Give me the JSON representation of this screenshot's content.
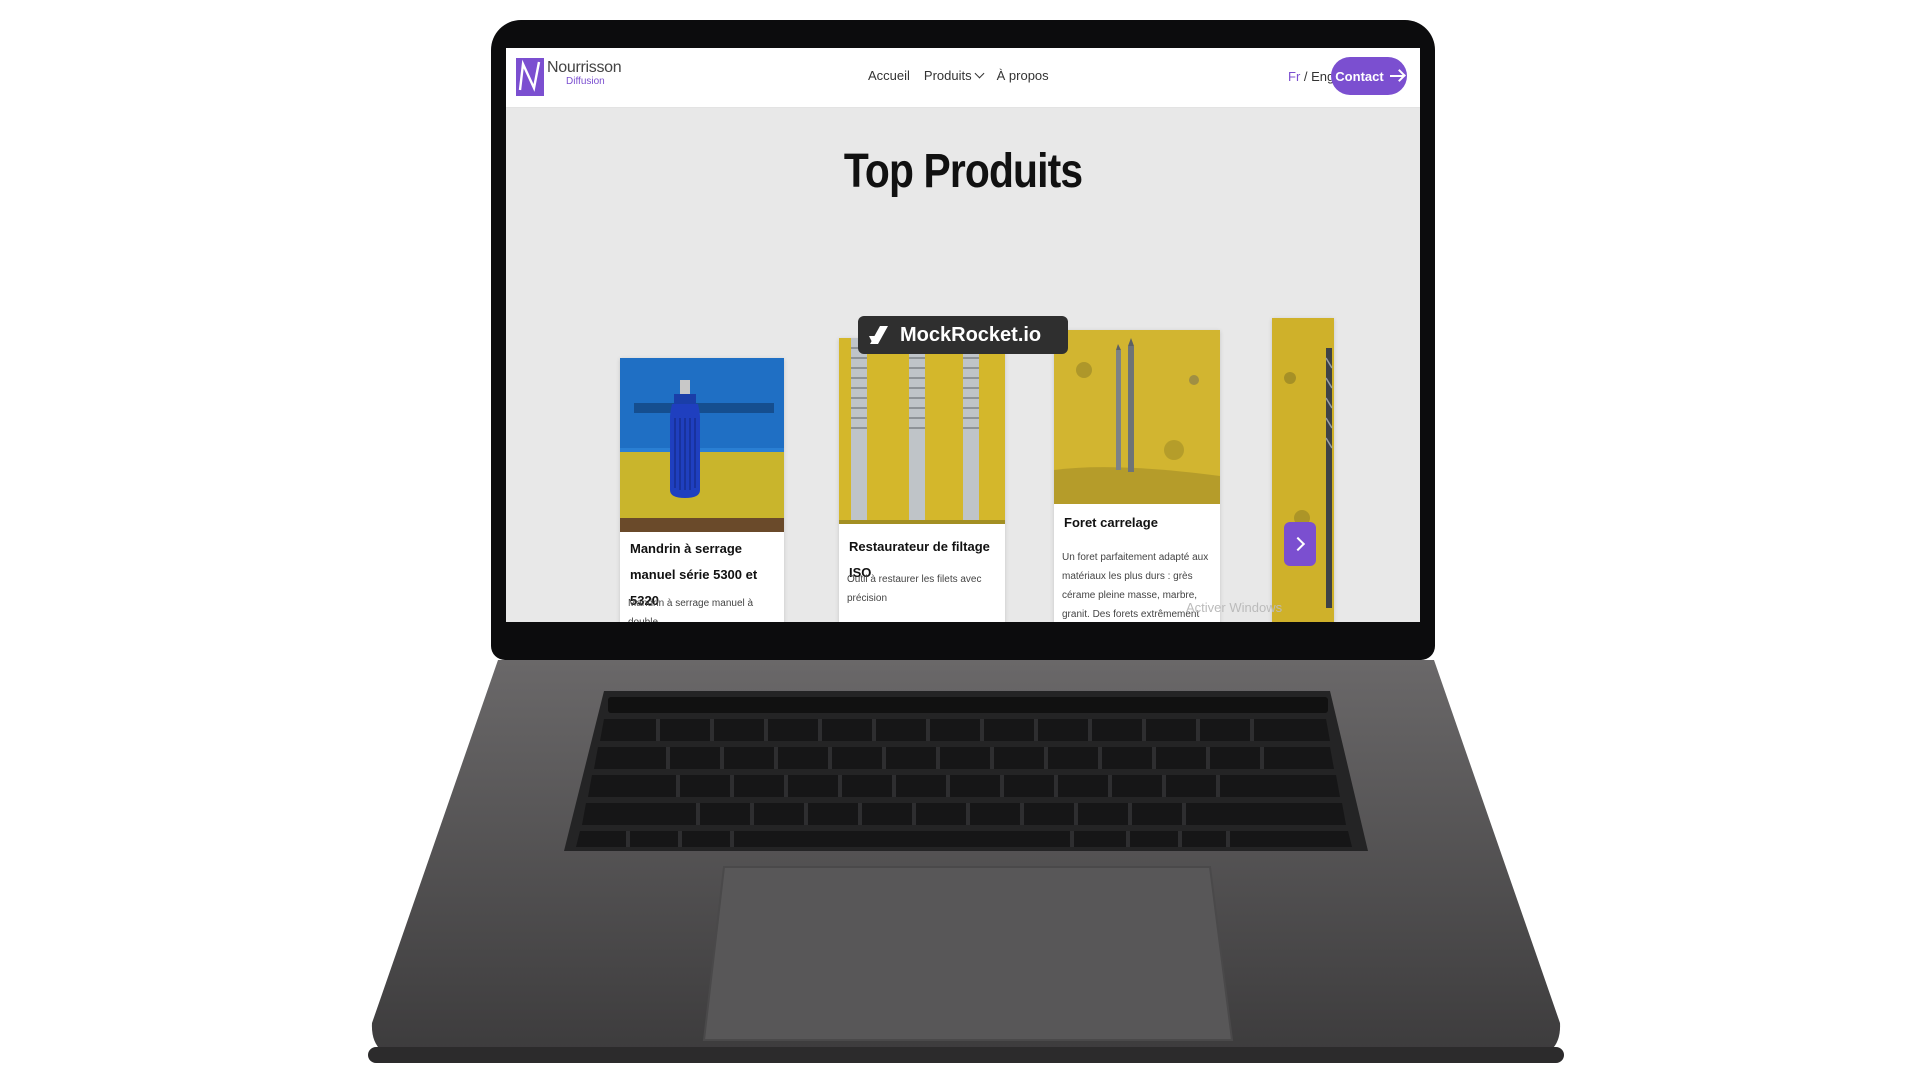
{
  "nav": {
    "brand_name": "Nourrisson",
    "brand_sub": "Diffusion",
    "links": [
      "Accueil",
      "Produits",
      "À propos"
    ],
    "lang_fr": "Fr",
    "lang_sep": " / ",
    "lang_en": "Eng",
    "contact_label": "Contact"
  },
  "section": {
    "title": "Top Produits"
  },
  "products": [
    {
      "title": "Mandrin à serrage manuel série 5300 et 5320",
      "desc": "Mandrin à serrage manuel à double"
    },
    {
      "title": "Restaurateur de filtage ISO",
      "desc": "Outil à restaurer les filets avec précision"
    },
    {
      "title": "Foret carrelage",
      "desc": "Un foret parfaitement adapté aux matériaux les plus durs : grès cérame pleine masse, marbre, granit. Des forets extrêmement performants grâce à"
    }
  ],
  "overlay": {
    "watermark": "Activer Windows",
    "badge": "MockRocket.io"
  },
  "icons": {
    "logo": "n-logo-icon",
    "produits_dropdown": "chevron-down-icon",
    "contact": "arrow-right-icon",
    "carousel_next": "chevron-right-icon",
    "badge": "rocket-icon"
  },
  "colors": {
    "accent": "#7b4fd0",
    "page_bg": "#e8e8e8",
    "product_bg_yellow": "#d4b72b",
    "product_bg_blue": "#2a7fd3"
  }
}
